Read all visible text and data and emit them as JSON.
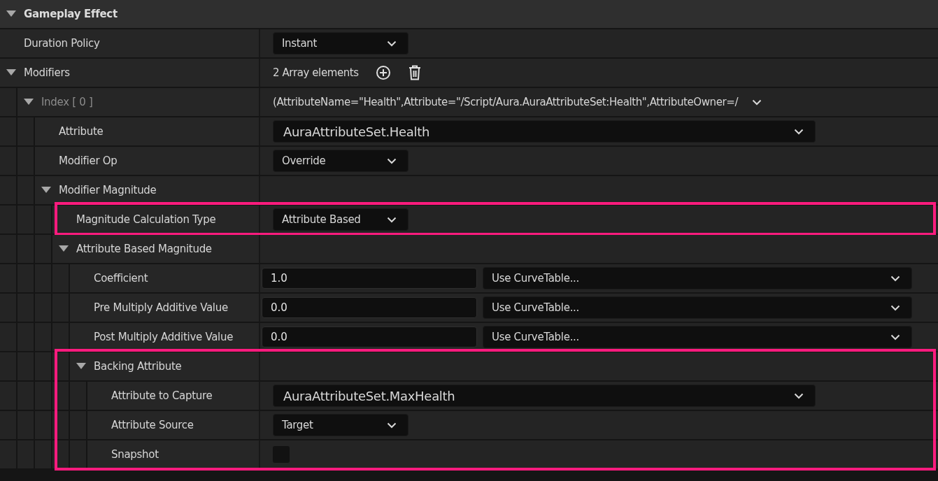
{
  "details": [
    {
      "kind": "category",
      "name": "Gameplay Effect",
      "expanded": true,
      "children": [
        {
          "kind": "enum",
          "name": "Duration Policy",
          "value": "Instant"
        },
        {
          "kind": "array",
          "name": "Modifiers",
          "value": "2 Array elements",
          "expanded": true,
          "children": [
            {
              "kind": "summary",
              "name": "Index [ 0 ]",
              "value": "(AttributeName=\"Health\",Attribute=\"/Script/Aura.AuraAttributeSet:Health\",AttributeOwner=/",
              "expanded": true,
              "children": [
                {
                  "kind": "asset",
                  "name": "Attribute",
                  "value": "AuraAttributeSet.Health"
                },
                {
                  "kind": "enum",
                  "name": "Modifier Op",
                  "value": "Override"
                },
                {
                  "kind": "group",
                  "name": "Modifier Magnitude",
                  "expanded": true,
                  "children": [
                    {
                      "kind": "enum",
                      "name": "Magnitude Calculation Type",
                      "value": "Attribute Based",
                      "highlighted": true
                    },
                    {
                      "kind": "group",
                      "name": "Attribute Based Magnitude",
                      "expanded": true,
                      "children": [
                        {
                          "kind": "scalable",
                          "name": "Coefficient",
                          "value": "1.0",
                          "curve": "Use CurveTable..."
                        },
                        {
                          "kind": "scalable",
                          "name": "Pre Multiply Additive Value",
                          "value": "0.0",
                          "curve": "Use CurveTable..."
                        },
                        {
                          "kind": "scalable",
                          "name": "Post Multiply Additive Value",
                          "value": "0.0",
                          "curve": "Use CurveTable..."
                        },
                        {
                          "kind": "group",
                          "name": "Backing Attribute",
                          "expanded": true,
                          "highlighted": true,
                          "children": [
                            {
                              "kind": "asset",
                              "name": "Attribute to Capture",
                              "value": "AuraAttributeSet.MaxHealth"
                            },
                            {
                              "kind": "enum",
                              "name": "Attribute Source",
                              "value": "Target"
                            },
                            {
                              "kind": "checkbox",
                              "name": "Snapshot",
                              "checked": false
                            }
                          ]
                        }
                      ]
                    }
                  ]
                }
              ]
            }
          ]
        }
      ]
    }
  ]
}
